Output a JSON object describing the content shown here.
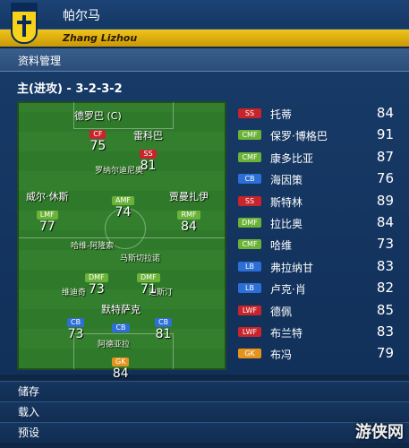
{
  "header": {
    "club_name": "帕尔马",
    "manager_name": "Zhang Lizhou"
  },
  "section": {
    "title": "资料管理"
  },
  "formation": {
    "label": "主(进攻) - 3-2-3-2"
  },
  "pitch_players": [
    {
      "name": "德罗巴 (C)",
      "pos": "CF",
      "rating": "75",
      "color": "red"
    },
    {
      "name": "雷科巴",
      "pos": "SS",
      "rating": "81",
      "color": "red"
    },
    {
      "name": "威尔·休斯",
      "pos": "LMF",
      "rating": "77",
      "color": "green"
    },
    {
      "name": "",
      "pos": "AMF",
      "rating": "74",
      "color": "green"
    },
    {
      "name": "贾曼扎伊",
      "pos": "RMF",
      "rating": "84",
      "color": "green"
    },
    {
      "name": "",
      "pos": "DMF",
      "rating": "73",
      "color": "green"
    },
    {
      "name": "",
      "pos": "DMF",
      "rating": "71",
      "color": "green"
    },
    {
      "name": "",
      "pos": "CB",
      "rating": "73",
      "color": "blue"
    },
    {
      "name": "默特萨克",
      "pos": "CB",
      "rating": "",
      "color": "blue"
    },
    {
      "name": "",
      "pos": "CB",
      "rating": "81",
      "color": "blue"
    },
    {
      "name": "",
      "pos": "GK",
      "rating": "84",
      "color": "orange"
    }
  ],
  "pitch_small_labels": [
    "罗纳尔迪尼奥",
    "哈维-阿隆索",
    "马斯切拉诺",
    "维迪奇",
    "迪斯汀",
    "阿德亚拉"
  ],
  "roster": [
    {
      "pos": "SS",
      "name": "托蒂",
      "rating": "84",
      "color": "#c8242c"
    },
    {
      "pos": "CMF",
      "name": "保罗·博格巴",
      "rating": "91",
      "color": "#6bb238"
    },
    {
      "pos": "CMF",
      "name": "康多比亚",
      "rating": "87",
      "color": "#6bb238"
    },
    {
      "pos": "CB",
      "name": "海因策",
      "rating": "76",
      "color": "#2c6fd6"
    },
    {
      "pos": "SS",
      "name": "斯特林",
      "rating": "89",
      "color": "#c8242c"
    },
    {
      "pos": "DMF",
      "name": "拉比奥",
      "rating": "84",
      "color": "#6bb238"
    },
    {
      "pos": "CMF",
      "name": "哈维",
      "rating": "73",
      "color": "#6bb238"
    },
    {
      "pos": "LB",
      "name": "弗拉纳甘",
      "rating": "83",
      "color": "#2c6fd6"
    },
    {
      "pos": "LB",
      "name": "卢克·肖",
      "rating": "82",
      "color": "#2c6fd6"
    },
    {
      "pos": "LWF",
      "name": "德佩",
      "rating": "85",
      "color": "#c8242c"
    },
    {
      "pos": "LWF",
      "name": "布兰特",
      "rating": "83",
      "color": "#c8242c"
    },
    {
      "pos": "GK",
      "name": "布冯",
      "rating": "79",
      "color": "#e5931c"
    }
  ],
  "menu": {
    "items": [
      "储存",
      "载入",
      "预设"
    ]
  },
  "watermark": "游侠网"
}
